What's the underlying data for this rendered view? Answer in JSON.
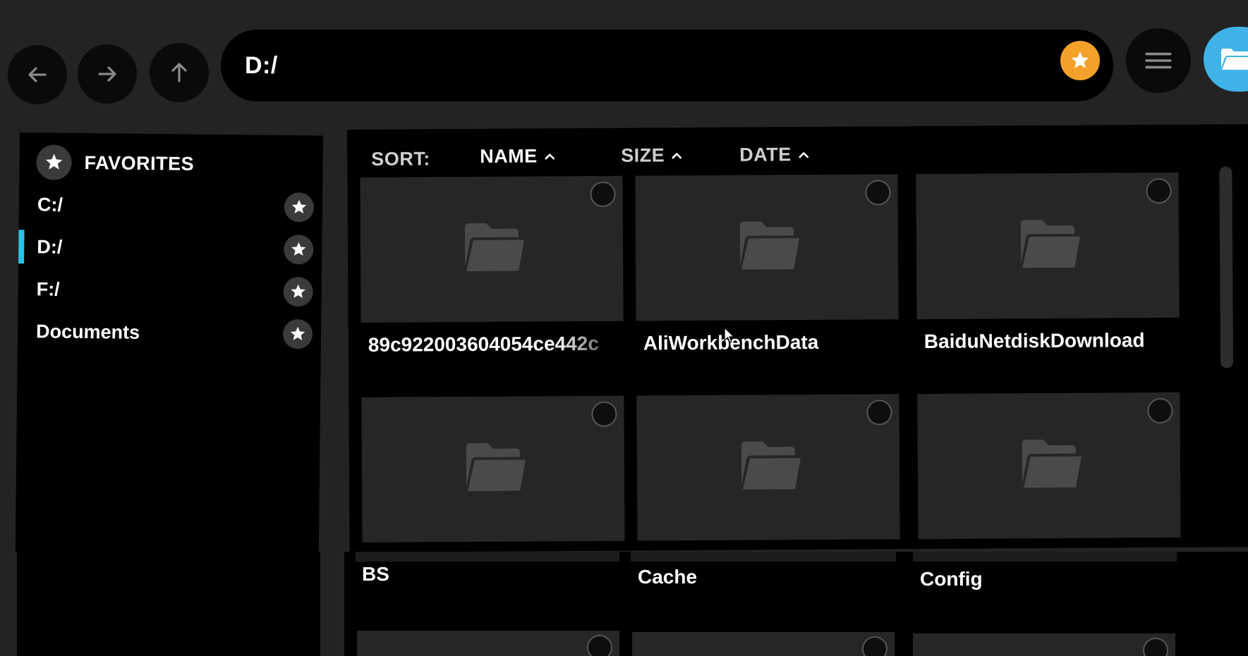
{
  "toolbar": {
    "back_icon": "arrow-left-icon",
    "forward_icon": "arrow-right-icon",
    "up_icon": "arrow-up-icon",
    "address": "D:/",
    "favorite_icon": "star-icon",
    "favorite_color": "#f4a12a",
    "menu_icon": "hamburger-menu-icon",
    "open_folder_icon": "folder-open-icon",
    "open_folder_color": "#3fb3e8"
  },
  "sidebar": {
    "header": "FAVORITES",
    "items": [
      {
        "label": "C:/",
        "active": false
      },
      {
        "label": "D:/",
        "active": true
      },
      {
        "label": "F:/",
        "active": false
      },
      {
        "label": "Documents",
        "active": false
      }
    ],
    "active_color": "#27c3e8"
  },
  "content": {
    "sort": {
      "label": "SORT:",
      "options": [
        {
          "label": "NAME",
          "direction": "ascending"
        },
        {
          "label": "SIZE",
          "direction": "ascending"
        },
        {
          "label": "DATE",
          "direction": "ascending"
        }
      ]
    },
    "folders": [
      {
        "name": "89c922003604054ce442c"
      },
      {
        "name": "AliWorkbenchData"
      },
      {
        "name": "BaiduNetdiskDownload"
      },
      {
        "name": "BS"
      },
      {
        "name": "Cache"
      },
      {
        "name": "Config"
      }
    ]
  }
}
